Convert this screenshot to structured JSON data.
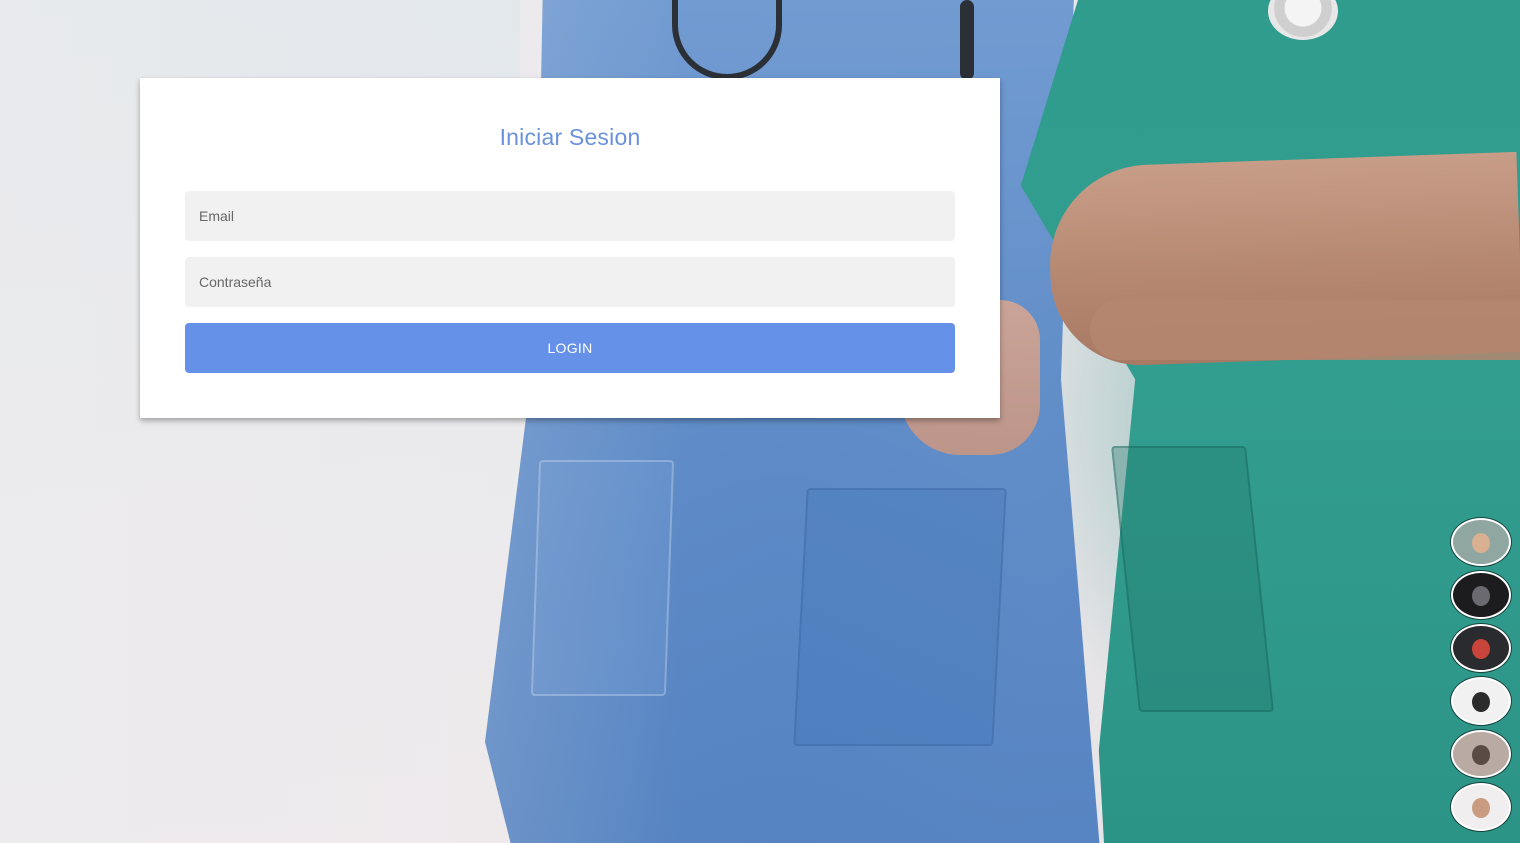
{
  "login": {
    "title": "Iniciar Sesion",
    "email_placeholder": "Email",
    "password_placeholder": "Contraseña",
    "login_label": "LOGIN"
  },
  "colors": {
    "accent": "#6592e8",
    "title": "#6a92dc",
    "field_bg": "#f1f1f1"
  },
  "avatars": [
    {
      "name": "avatar-1",
      "bg": "#8fa7a0",
      "face": "#d9b092"
    },
    {
      "name": "avatar-2",
      "bg": "#1c1c1f",
      "face": "#6a6a70"
    },
    {
      "name": "avatar-3",
      "bg": "#2a2b2e",
      "face": "#c9453b"
    },
    {
      "name": "avatar-4",
      "bg": "#f1f1f1",
      "face": "#2b2b2b"
    },
    {
      "name": "avatar-5",
      "bg": "#b9aaa4",
      "face": "#5b4b45"
    },
    {
      "name": "avatar-6",
      "bg": "#f0eeee",
      "face": "#c99b80"
    }
  ]
}
